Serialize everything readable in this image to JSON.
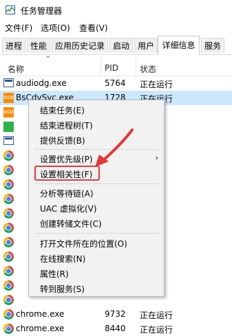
{
  "window": {
    "title": "任务管理器",
    "icon": "task-manager-icon"
  },
  "menu": [
    "文件(F)",
    "选项(O)",
    "查看(V)"
  ],
  "tabs": [
    "进程",
    "性能",
    "应用历史记录",
    "启动",
    "用户",
    "详细信息",
    "服务"
  ],
  "active_tab": "详细信息",
  "columns": {
    "name": "名称",
    "pid": "PID",
    "status": "状态"
  },
  "rows": [
    {
      "name": "audiodg.exe",
      "pid": "5764",
      "status": "正在运行",
      "icon": "app-blue-icon"
    },
    {
      "name": "BsCdvSvc.exe",
      "pid": "1728",
      "status": "正在运行",
      "icon": "ccu-icon"
    },
    {
      "name": "",
      "pid": "",
      "status": "",
      "icon": "ccu-icon"
    },
    {
      "name": "",
      "pid": "",
      "status": "",
      "icon": "green-icon"
    },
    {
      "name": "",
      "pid": "",
      "status": "",
      "icon": "app-blue-icon"
    },
    {
      "name": "",
      "pid": "",
      "status": "",
      "icon": "chrome-icon"
    },
    {
      "name": "",
      "pid": "",
      "status": "",
      "icon": "chrome-icon"
    },
    {
      "name": "",
      "pid": "",
      "status": "",
      "icon": "chrome-icon"
    },
    {
      "name": "",
      "pid": "",
      "status": "",
      "icon": "chrome-icon"
    },
    {
      "name": "",
      "pid": "",
      "status": "",
      "icon": "chrome-icon"
    },
    {
      "name": "",
      "pid": "",
      "status": "",
      "icon": "chrome-icon"
    },
    {
      "name": "",
      "pid": "",
      "status": "",
      "icon": "chrome-icon"
    },
    {
      "name": "",
      "pid": "",
      "status": "",
      "icon": "chrome-icon"
    },
    {
      "name": "",
      "pid": "",
      "status": "",
      "icon": "chrome-icon"
    },
    {
      "name": "",
      "pid": "",
      "status": "",
      "icon": "chrome-icon"
    },
    {
      "name": "",
      "pid": "",
      "status": "",
      "icon": "chrome-icon"
    },
    {
      "name": "chrome.exe",
      "pid": "9732",
      "status": "正在运行",
      "icon": "chrome-icon"
    },
    {
      "name": "chrome.exe",
      "pid": "8440",
      "status": "正在运行",
      "icon": "chrome-icon"
    }
  ],
  "context_menu": {
    "items": [
      "结束任务(E)",
      "结束进程树(T)",
      "提供反馈(B)",
      "设置优先级(P)",
      "设置相关性(F)",
      "分析等待链(A)",
      "UAC 虚拟化(V)",
      "创建转储文件(C)",
      "打开文件所在的位置(O)",
      "在线搜索(N)",
      "属性(R)",
      "转到服务(S)"
    ],
    "highlighted": "设置相关性(F)"
  },
  "annotation": {
    "color": "#e53935"
  }
}
